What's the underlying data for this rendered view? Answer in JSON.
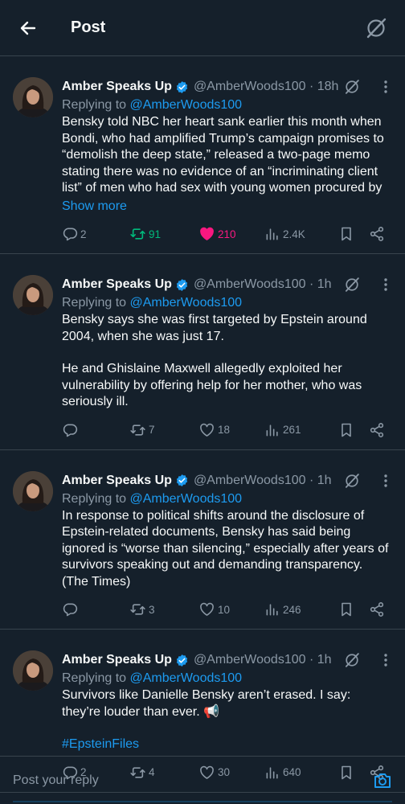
{
  "header": {
    "title": "Post"
  },
  "tweets": [
    {
      "name": "Amber Speaks Up",
      "handle": "@AmberWoods100",
      "time": "18h",
      "replying_label": "Replying to",
      "replying_to": "@AmberWoods100",
      "paragraphs": [
        "Bensky told NBC her heart sank earlier this month when Bondi, who had amplified Trump’s campaign promises to “demolish the deep state,” released a two-page memo stating there was no evidence of an “incriminating client list” of men who had sex with young women procured by"
      ],
      "show_more": "Show more",
      "hashtag": "",
      "replies": "2",
      "retweets": "91",
      "likes": "210",
      "views": "2.4K",
      "liked": true,
      "retweeted": true
    },
    {
      "name": "Amber Speaks Up",
      "handle": "@AmberWoods100",
      "time": "1h",
      "replying_label": "Replying to",
      "replying_to": "@AmberWoods100",
      "paragraphs": [
        "Bensky says she was first targeted by Epstein around 2004, when she was just 17.",
        "He and Ghislaine Maxwell allegedly exploited her vulnerability by offering help for her mother, who was seriously ill."
      ],
      "show_more": "",
      "hashtag": "",
      "replies": "",
      "retweets": "7",
      "likes": "18",
      "views": "261",
      "liked": false,
      "retweeted": false
    },
    {
      "name": "Amber Speaks Up",
      "handle": "@AmberWoods100",
      "time": "1h",
      "replying_label": "Replying to",
      "replying_to": "@AmberWoods100",
      "paragraphs": [
        "In response to political shifts around the disclosure of Epstein-related documents, Bensky has said being ignored is “worse than silencing,” especially after years of survivors speaking out and demanding transparency. (The Times)"
      ],
      "show_more": "",
      "hashtag": "",
      "replies": "",
      "retweets": "3",
      "likes": "10",
      "views": "246",
      "liked": false,
      "retweeted": false
    },
    {
      "name": "Amber Speaks Up",
      "handle": "@AmberWoods100",
      "time": "1h",
      "replying_label": "Replying to",
      "replying_to": "@AmberWoods100",
      "paragraphs": [
        "Survivors like Danielle Bensky aren’t erased. I say: they’re louder than ever. 📢"
      ],
      "show_more": "",
      "hashtag": "#EpsteinFiles",
      "replies": "2",
      "retweets": "4",
      "likes": "30",
      "views": "640",
      "liked": false,
      "retweeted": false
    }
  ],
  "reply_bar": {
    "placeholder": "Post your reply"
  },
  "colors": {
    "background": "#15202b",
    "accent": "#1d9bf0",
    "retweet": "#00ba7c",
    "like": "#f91880",
    "muted": "#8b98a5"
  },
  "icons": [
    "back-arrow-icon",
    "grok-icon",
    "verified-icon",
    "more-icon",
    "reply-icon",
    "retweet-icon",
    "heart-icon",
    "views-icon",
    "bookmark-icon",
    "share-icon",
    "camera-icon"
  ]
}
